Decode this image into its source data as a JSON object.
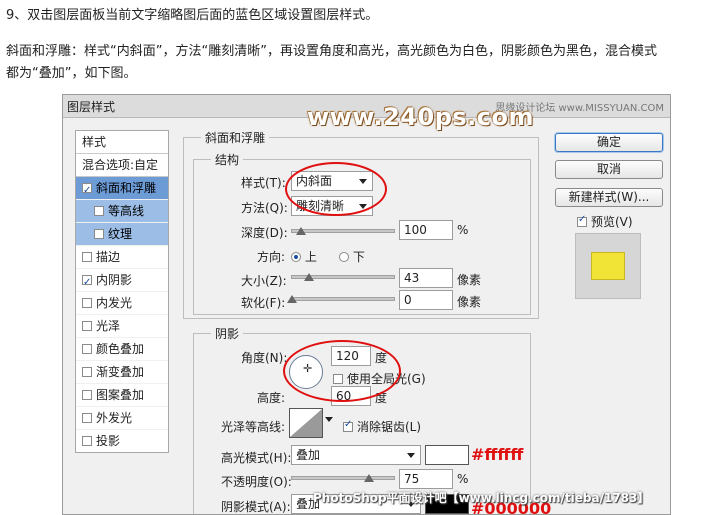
{
  "article": {
    "line1": "9、双击图层面板当前文字缩略图后面的蓝色区域设置图层样式。",
    "line2": "斜面和浮雕：样式“内斜面”，方法“雕刻清晰”，再设置角度和高光，高光颜色为白色，阴影颜色为黑色，混合模式",
    "line3": "都为“叠加”，如下图。"
  },
  "dialog": {
    "title": "图层样式",
    "watermark": "www.240ps.com",
    "site_mark": "思缘设计论坛 www.MISSYUAN.COM",
    "bottom_watermark": "PhotoShop平面设计吧【www.lincg.com/tieba/1783】"
  },
  "sidebar": {
    "header": "样式",
    "blend": "混合选项:自定",
    "items": [
      {
        "label": "斜面和浮雕",
        "checked": true
      },
      {
        "label": "等高线",
        "checked": false
      },
      {
        "label": "纹理",
        "checked": false
      },
      {
        "label": "描边",
        "checked": false
      },
      {
        "label": "内阴影",
        "checked": true
      },
      {
        "label": "内发光",
        "checked": false
      },
      {
        "label": "光泽",
        "checked": false
      },
      {
        "label": "颜色叠加",
        "checked": false
      },
      {
        "label": "渐变叠加",
        "checked": false
      },
      {
        "label": "图案叠加",
        "checked": false
      },
      {
        "label": "外发光",
        "checked": false
      },
      {
        "label": "投影",
        "checked": false
      }
    ]
  },
  "bevel": {
    "group_title": "斜面和浮雕",
    "structure_title": "结构",
    "style_label": "样式(T):",
    "style_value": "内斜面",
    "technique_label": "方法(Q):",
    "technique_value": "雕刻清晰",
    "depth_label": "深度(D):",
    "depth_value": "100",
    "depth_unit": "%",
    "direction_label": "方向:",
    "dir_up": "上",
    "dir_down": "下",
    "size_label": "大小(Z):",
    "size_value": "43",
    "size_unit": "像素",
    "soften_label": "软化(F):",
    "soften_value": "0",
    "soften_unit": "像素"
  },
  "shading": {
    "title": "阴影",
    "angle_label": "角度(N):",
    "angle_value": "120",
    "angle_unit": "度",
    "global_light_label": "使用全局光(G)",
    "altitude_label": "高度:",
    "altitude_value": "60",
    "altitude_unit": "度",
    "gloss_label": "光泽等高线:",
    "antialias_label": "消除锯齿(L)",
    "highlight_mode_label": "高光模式(H):",
    "highlight_mode_value": "叠加",
    "highlight_color_label": "#ffffff",
    "opacity_label": "不透明度(O):",
    "opacity_value": "75",
    "opacity_unit": "%",
    "shadow_mode_label": "阴影模式(A):",
    "shadow_mode_value": "叠加",
    "shadow_color_label": "#000000"
  },
  "buttons": {
    "ok": "确定",
    "cancel": "取消",
    "new_style": "新建样式(W)...",
    "preview": "预览(V)"
  },
  "colors": {
    "accent": "#6c9bd6",
    "annotation": "#e01010",
    "preview_fill": "#f2e436"
  },
  "values": {
    "depth_fraction": 0.1,
    "size_fraction": 0.17,
    "opacity_fraction": 0.75
  }
}
